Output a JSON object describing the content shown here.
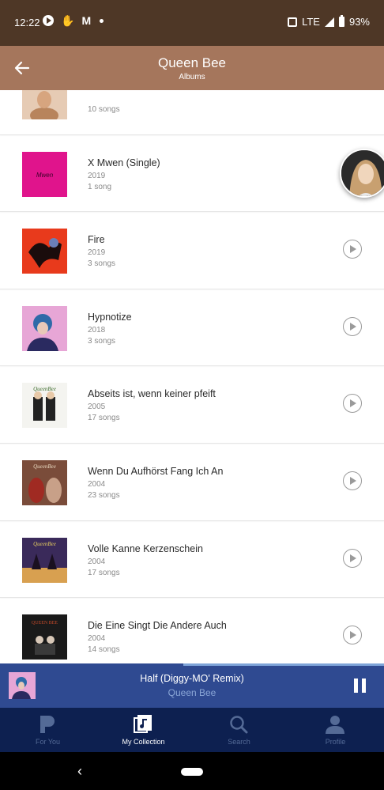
{
  "status_bar": {
    "time": "12:22",
    "network": "LTE",
    "battery": "93%",
    "icons": [
      "pandora-play-icon",
      "hand-icon",
      "mcdonalds-icon",
      "notification-dot-icon",
      "vibrate-icon",
      "signal-icon",
      "battery-icon"
    ]
  },
  "header": {
    "title": "Queen Bee",
    "subtitle": "Albums",
    "back_icon": "arrow-left-icon"
  },
  "albums": [
    {
      "name": "",
      "year": "",
      "songs": "10 songs",
      "cover_color": "#d8b090"
    },
    {
      "name": "X Mwen (Single)",
      "year": "2019",
      "songs": "1 song",
      "cover_text": "Mwen",
      "cover_color": "#e0148c"
    },
    {
      "name": "Fire",
      "year": "2019",
      "songs": "3 songs",
      "cover_color": "#e83a1c"
    },
    {
      "name": "Hypnotize",
      "year": "2018",
      "songs": "3 songs",
      "cover_color": "#e7a6d6"
    },
    {
      "name": "Abseits ist, wenn keiner pfeift",
      "year": "2005",
      "songs": "17 songs",
      "cover_text": "QueenBee",
      "cover_color": "#f4f4f0"
    },
    {
      "name": "Wenn Du Aufhörst Fang Ich An",
      "year": "2004",
      "songs": "23 songs",
      "cover_text": "QueenBee",
      "cover_color": "#7a4c3a"
    },
    {
      "name": "Volle Kanne Kerzenschein",
      "year": "2004",
      "songs": "17 songs",
      "cover_text": "QueenBee",
      "cover_color": "#3a2a5a"
    },
    {
      "name": "Die Eine Singt Die Andere Auch",
      "year": "2004",
      "songs": "14 songs",
      "cover_text": "QUEEN BEE",
      "cover_color": "#1a1a1a"
    }
  ],
  "now_playing": {
    "title": "Half (Diggy-MO' Remix)",
    "artist": "Queen Bee",
    "progress": 0.48,
    "pause_icon": "pause-icon"
  },
  "bottom_nav": [
    {
      "label": "For You",
      "icon": "pandora-logo-icon",
      "active": false
    },
    {
      "label": "My Collection",
      "icon": "collection-icon",
      "active": true
    },
    {
      "label": "Search",
      "icon": "search-icon",
      "active": false
    },
    {
      "label": "Profile",
      "icon": "profile-icon",
      "active": false
    }
  ],
  "colors": {
    "status_bar": "#4e3726",
    "app_bar": "#a5765c",
    "mini_player": "#2f4a91",
    "bottom_nav": "#0d2050"
  }
}
